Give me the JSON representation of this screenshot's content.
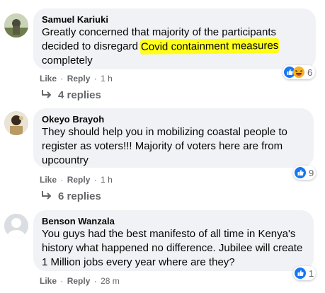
{
  "actions": {
    "like": "Like",
    "reply": "Reply",
    "sep": "·"
  },
  "comments": [
    {
      "author": "Samuel Kariuki",
      "text_before": "Greatly concerned that majority of the participants decided to disregard ",
      "text_highlight": "Covid containment measures",
      "text_after": " completely",
      "time": "1 h",
      "reaction_count": "6",
      "replies_label": "4 replies"
    },
    {
      "author": "Okeyo Brayoh",
      "text": "They should help you in mobilizing coastal people to register as voters!!! Majority of voters here are from upcountry",
      "time": "1 h",
      "reaction_count": "9",
      "replies_label": "6 replies"
    },
    {
      "author": "Benson Wanzala",
      "text": "You guys had the best manifesto of all time in Kenya's history what happened no difference. Jubilee will create 1 Million jobs every year where are they?",
      "time": "28 m",
      "reaction_count": "1"
    }
  ],
  "colors": {
    "bubble": "#f0f2f5",
    "secondary_text": "#65676b",
    "like_blue": "#1877f2",
    "haha_yellow": "#f7b125",
    "highlight": "#ffff1a"
  }
}
